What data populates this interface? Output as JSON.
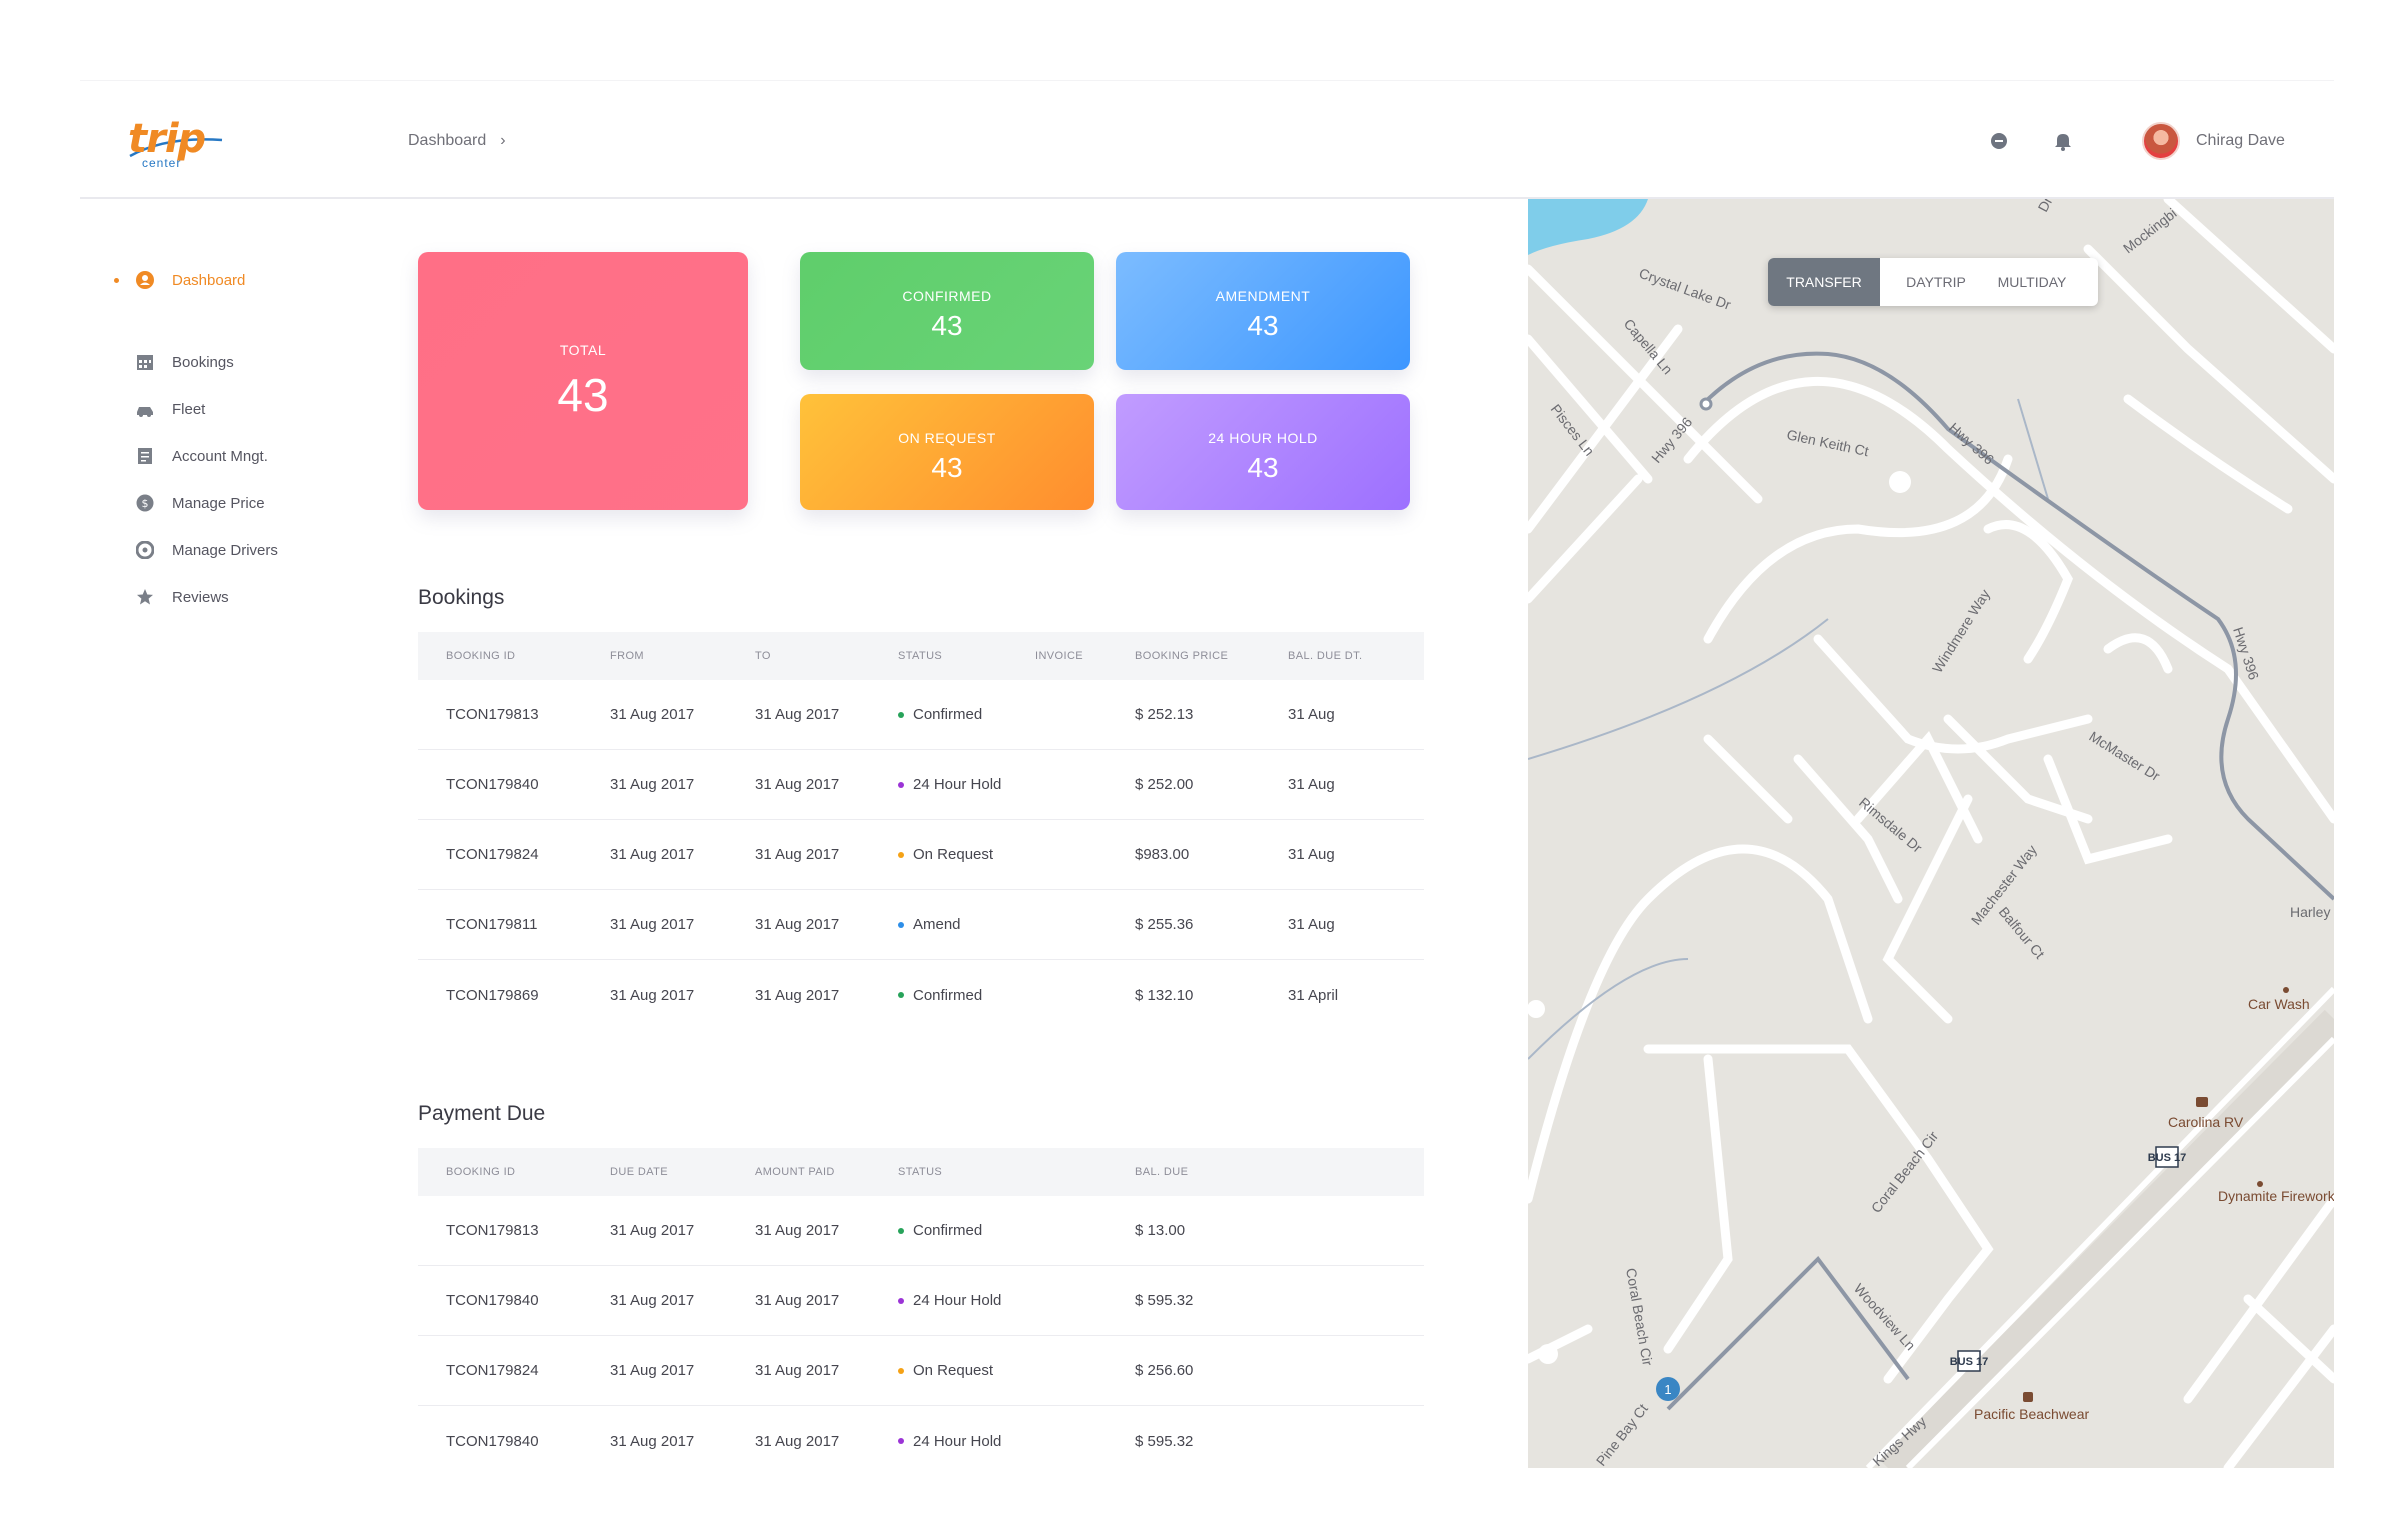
{
  "brand": {
    "logo_word": "trip",
    "logo_sub": "center"
  },
  "header": {
    "breadcrumb": "Dashboard",
    "breadcrumb_sep": "›",
    "user_name": "Chirag Dave",
    "icons": [
      "chat-icon",
      "bell-icon"
    ]
  },
  "sidebar": {
    "items": [
      {
        "label": "Dashboard",
        "icon": "user-circle-icon",
        "active": true
      },
      {
        "label": "Bookings",
        "icon": "calendar-icon"
      },
      {
        "label": "Fleet",
        "icon": "car-icon"
      },
      {
        "label": "Account Mngt.",
        "icon": "document-icon"
      },
      {
        "label": "Manage Price",
        "icon": "dollar-icon"
      },
      {
        "label": "Manage Drivers",
        "icon": "drivers-icon"
      },
      {
        "label": "Reviews",
        "icon": "star-icon"
      }
    ]
  },
  "stats": {
    "total": {
      "label": "TOTAL",
      "value": "43",
      "color": "#ff6f86"
    },
    "confirmed": {
      "label": "CONFIRMED",
      "value": "43",
      "color": "#5fce6b"
    },
    "amendment": {
      "label": "AMENDMENT",
      "value": "43",
      "color": "#4aa2ff"
    },
    "on_request": {
      "label": "ON REQUEST",
      "value": "43",
      "color": "#ffa733"
    },
    "hold": {
      "label": "24 HOUR HOLD",
      "value": "43",
      "color": "#a87cff"
    }
  },
  "bookings": {
    "title": "Bookings",
    "columns": [
      "BOOKING ID",
      "FROM",
      "TO",
      "STATUS",
      "INVOICE",
      "BOOKING PRICE",
      "BAL. DUE DT."
    ],
    "rows": [
      {
        "id": "TCON179813",
        "from": "31 Aug 2017",
        "to": "31 Aug 2017",
        "status": "Confirmed",
        "status_color": "#27a35a",
        "invoice": "",
        "price": "$ 252.13",
        "due": "31 Aug"
      },
      {
        "id": "TCON179840",
        "from": "31 Aug 2017",
        "to": "31 Aug 2017",
        "status": "24 Hour Hold",
        "status_color": "#9b34d6",
        "invoice": "",
        "price": "$ 252.00",
        "due": "31 Aug"
      },
      {
        "id": "TCON179824",
        "from": "31 Aug 2017",
        "to": "31 Aug 2017",
        "status": "On Request",
        "status_color": "#f5a216",
        "invoice": "",
        "price": "$983.00",
        "due": "31 Aug"
      },
      {
        "id": "TCON179811",
        "from": "31 Aug 2017",
        "to": "31 Aug 2017",
        "status": "Amend",
        "status_color": "#2d8ee8",
        "invoice": "",
        "price": "$ 255.36",
        "due": "31 Aug"
      },
      {
        "id": "TCON179869",
        "from": "31 Aug 2017",
        "to": "31 Aug 2017",
        "status": "Confirmed",
        "status_color": "#27a35a",
        "invoice": "",
        "price": "$ 132.10",
        "due": "31 April"
      }
    ]
  },
  "payment": {
    "title": "Payment Due",
    "columns": [
      "BOOKING ID",
      "DUE DATE",
      "AMOUNT PAID",
      "STATUS",
      "BAL. DUE"
    ],
    "rows": [
      {
        "id": "TCON179813",
        "due_date": "31 Aug 2017",
        "paid": "31 Aug 2017",
        "status": "Confirmed",
        "status_color": "#27a35a",
        "bal": "$ 13.00"
      },
      {
        "id": "TCON179840",
        "due_date": "31 Aug 2017",
        "paid": "31 Aug 2017",
        "status": "24 Hour Hold",
        "status_color": "#9b34d6",
        "bal": "$ 595.32"
      },
      {
        "id": "TCON179824",
        "due_date": "31 Aug 2017",
        "paid": "31 Aug 2017",
        "status": "On Request",
        "status_color": "#f5a216",
        "bal": "$ 256.60"
      },
      {
        "id": "TCON179840",
        "due_date": "31 Aug 2017",
        "paid": "31 Aug 2017",
        "status": "24 Hour Hold",
        "status_color": "#9b34d6",
        "bal": "$ 595.32"
      }
    ]
  },
  "map": {
    "tabs": [
      "TRANSFER",
      "DAYTRIP",
      "MULTIDAY"
    ],
    "active_tab": "TRANSFER",
    "labels": [
      "Crystal Lake Dr",
      "Capella Ln",
      "Pisces Ln",
      "Hwy 396",
      "Glen Keith Ct",
      "Hwy 396",
      "Hwy 396",
      "Windmere Way",
      "McMaster Dr",
      "Rimsdale Dr",
      "Machester Way",
      "Balfour Ct",
      "Coral Beach Cir",
      "Coral Beach Cir",
      "Woodview Ln",
      "Kings Hwy",
      "Pine Bay Ct",
      "Dr",
      "Mockingbi",
      "Harley Moto",
      "Car Wash",
      "Carolina RV",
      "Dynamite Fireworks",
      "Pacific Beachwear",
      "BUS 17",
      "BUS 17"
    ],
    "marker": "1"
  }
}
